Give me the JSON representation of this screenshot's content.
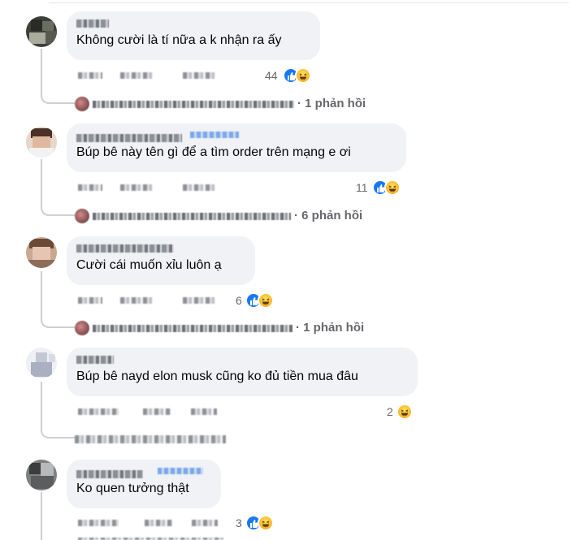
{
  "comments": [
    {
      "text": "Không cười là tí nữa a k nhận ra ấy",
      "reaction_count": "44",
      "reactions": [
        "like-icon",
        "haha-icon"
      ],
      "replies": "· 1 phản hồi"
    },
    {
      "text": "Búp bê này tên gì để a tìm order trên mạng e ơi",
      "reaction_count": "11",
      "reactions": [
        "like-icon",
        "haha-icon"
      ],
      "replies": "· 6 phản hồi"
    },
    {
      "text": "Cười cái muốn xỉu luôn ạ",
      "reaction_count": "6",
      "reactions": [
        "like-icon",
        "haha-icon"
      ],
      "replies": "· 1 phản hồi"
    },
    {
      "text": "Búp bê nayd elon musk cũng ko đủ tiền mua đâu",
      "reaction_count": "2",
      "reactions": [
        "haha-icon"
      ],
      "replies": ""
    },
    {
      "text": "Ko quen tưởng thật",
      "reaction_count": "3",
      "reactions": [
        "like-icon",
        "haha-icon"
      ],
      "replies": ""
    }
  ],
  "colors": {
    "bubble": "#f0f2f5",
    "like": "#1877f2",
    "haha": "#f7b125",
    "meta": "#65676b"
  }
}
